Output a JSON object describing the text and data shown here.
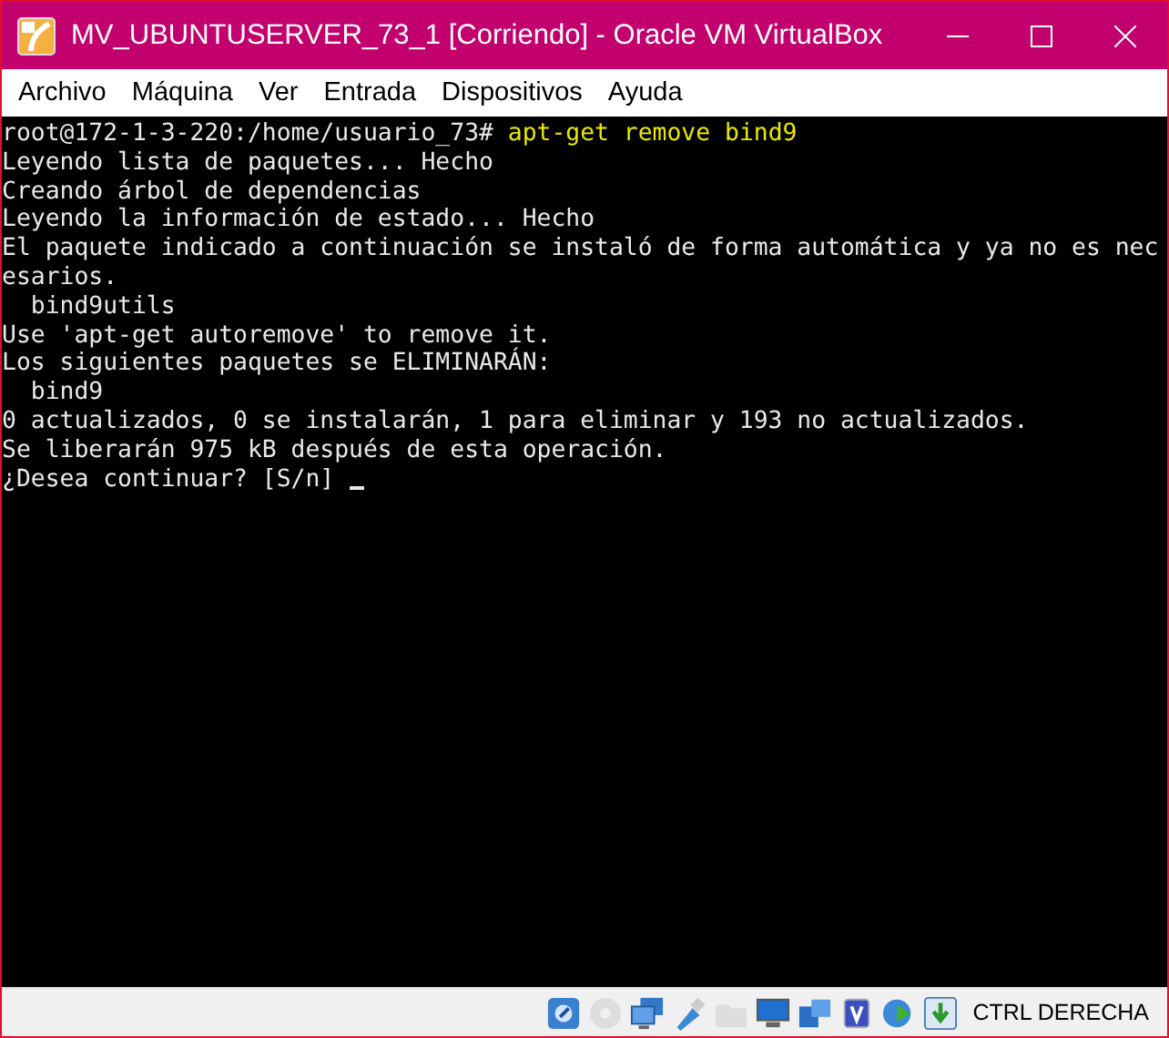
{
  "window": {
    "title": "MV_UBUNTUSERVER_73_1 [Corriendo] - Oracle VM VirtualBox"
  },
  "menu": [
    "Archivo",
    "Máquina",
    "Ver",
    "Entrada",
    "Dispositivos",
    "Ayuda"
  ],
  "terminal": {
    "lines": [
      {
        "kind": "prompt",
        "prompt": "root@172-1-3-220:/home/usuario_73#",
        "command": "apt-get remove bind9"
      },
      {
        "kind": "output",
        "text": "Leyendo lista de paquetes... Hecho"
      },
      {
        "kind": "output",
        "text": "Creando árbol de dependencias"
      },
      {
        "kind": "output",
        "text": "Leyendo la información de estado... Hecho"
      },
      {
        "kind": "output",
        "text": "El paquete indicado a continuación se instaló de forma automática y ya no es nec"
      },
      {
        "kind": "output",
        "text": "esarios."
      },
      {
        "kind": "output",
        "text": "  bind9utils"
      },
      {
        "kind": "output",
        "text": "Use 'apt-get autoremove' to remove it."
      },
      {
        "kind": "output",
        "text": "Los siguientes paquetes se ELIMINARÁN:"
      },
      {
        "kind": "output",
        "text": "  bind9"
      },
      {
        "kind": "output",
        "text": "0 actualizados, 0 se instalarán, 1 para eliminar y 193 no actualizados."
      },
      {
        "kind": "output",
        "text": "Se liberarán 975 kB después de esta operación."
      },
      {
        "kind": "input",
        "text": "¿Desea continuar? [S/n] "
      }
    ]
  },
  "status_bar": {
    "indicators": [
      {
        "kind": "disk",
        "disabled": false
      },
      {
        "kind": "optical",
        "disabled": true
      },
      {
        "kind": "network",
        "disabled": false
      },
      {
        "kind": "usb",
        "disabled": false
      },
      {
        "kind": "folder",
        "disabled": true
      },
      {
        "kind": "display",
        "disabled": false
      },
      {
        "kind": "capture",
        "disabled": false
      },
      {
        "kind": "cpu",
        "disabled": false
      },
      {
        "kind": "mouse",
        "disabled": false
      },
      {
        "kind": "keyboard",
        "disabled": false
      }
    ],
    "host_key": "CTRL DERECHA"
  }
}
